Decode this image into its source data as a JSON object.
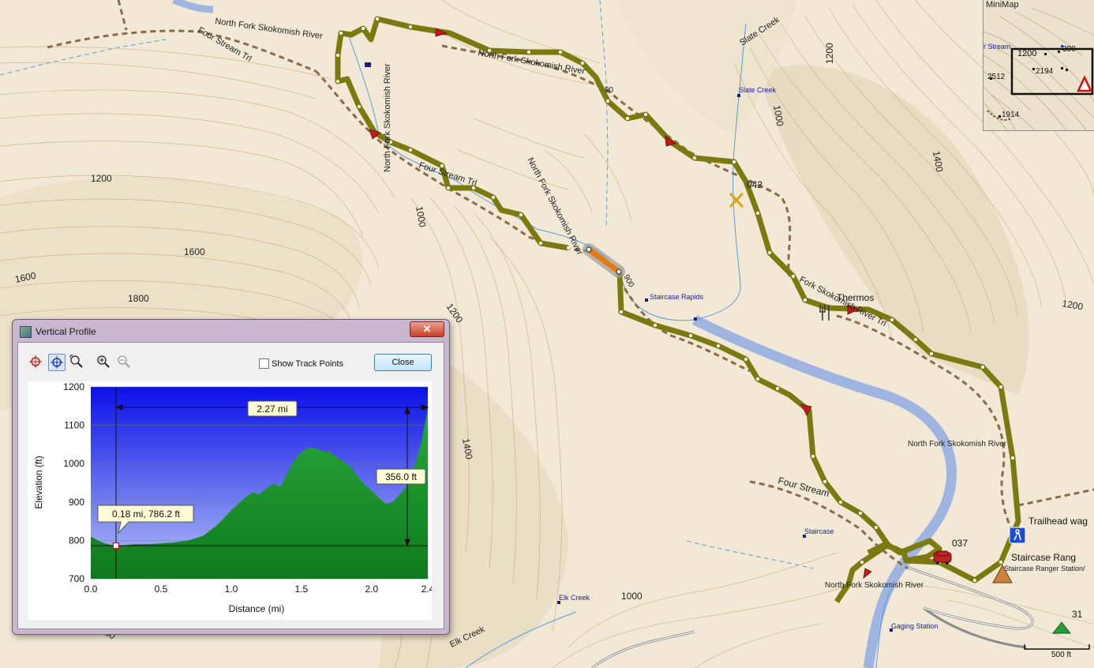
{
  "map": {
    "labels": {
      "north_fork_top": "North Fork Skokomish River",
      "four_stream_top": "Four Stream Trl",
      "slate_creek_label": "Slate Creek",
      "slate_creek_poi": "Slate Creek",
      "nf_river_vertical": "North Fork Skokomish River",
      "nf_river_mid": "North Fork Skokomish River",
      "nf_river_upper": "North Fork Skokomish River",
      "four_stream_mid": "Four Stream Trl",
      "staircase_rapids": "Staircase Rapids",
      "thermos": "Thermos",
      "fork_trl": "Fork Skokomish River Trl",
      "nf_river_right": "North Fork Skokomish River",
      "four_stream_low": "Four Stream",
      "staircase_poi": "Staircase",
      "trailhead": "Trailhead wag",
      "staircase_rang": "Staircase Rang",
      "staircase_ranger_station": "Staircase Ranger Station/",
      "nf_river_bottom": "North Fork Skokomish River",
      "elk_creek_poi": "Elk Creek",
      "elk_creek_label": "Elk Creek",
      "gaging_station": "Gaging Station",
      "wp_042": "042",
      "wp_037": "037",
      "wp_31": "31",
      "wp_90": "90",
      "wp_900": "900",
      "scale": "500 ft"
    },
    "contours": {
      "c1200_a": "1200",
      "c1000_a": "1000",
      "c1600_a": "1600",
      "c1600_b": "1600",
      "c1800_a": "1800",
      "c1200_b": "1200",
      "c1000_b": "1000",
      "c1400_a": "1400",
      "c1200_c": "1200",
      "c1400_b": "1400",
      "c1000_c": "1000",
      "c1800_b": "180",
      "c1200_d": "1200"
    }
  },
  "minimap": {
    "title": "MiniMap",
    "labels": {
      "stream": "r Stream",
      "e1200": "1200",
      "e390": "390",
      "e2512": "2512",
      "e2194": "2194",
      "e1914": "1914"
    }
  },
  "dialog": {
    "title": "Vertical Profile",
    "close_x": "✕",
    "show_track_points": "Show Track Points",
    "close_button": "Close"
  },
  "chart_data": {
    "type": "area",
    "xlabel": "Distance   (mi)",
    "ylabel": "Elevation (ft)",
    "xlim": [
      0,
      2.4
    ],
    "ylim": [
      700,
      1200
    ],
    "x_ticks": [
      "0.0",
      "0.5",
      "1.0",
      "1.5",
      "2.0",
      "2.4"
    ],
    "y_ticks": [
      "1200",
      "1100",
      "1000",
      "900",
      "800",
      "700"
    ],
    "x": [
      0.0,
      0.05,
      0.1,
      0.15,
      0.18,
      0.25,
      0.3,
      0.4,
      0.5,
      0.6,
      0.7,
      0.8,
      0.9,
      1.0,
      1.05,
      1.1,
      1.15,
      1.2,
      1.25,
      1.3,
      1.35,
      1.4,
      1.45,
      1.5,
      1.55,
      1.6,
      1.65,
      1.7,
      1.75,
      1.8,
      1.85,
      1.9,
      1.95,
      2.0,
      2.05,
      2.1,
      2.15,
      2.2,
      2.25,
      2.3,
      2.35,
      2.4
    ],
    "y": [
      810,
      800,
      792,
      788,
      786.2,
      788,
      790,
      790,
      792,
      795,
      800,
      812,
      840,
      878,
      895,
      912,
      925,
      920,
      935,
      948,
      940,
      975,
      1010,
      1030,
      1042,
      1040,
      1032,
      1030,
      1018,
      1005,
      992,
      968,
      945,
      930,
      912,
      895,
      900,
      920,
      940,
      990,
      1050,
      1142
    ],
    "cursor_label": "0.18 mi, 786.2 ft",
    "distance_label": "2.27 mi",
    "elevation_label": "356.0 ft",
    "colors": {
      "sky_top": "#0a10e8",
      "sky_bottom": "#b8c6f4",
      "fill_top": "#2aa83a",
      "fill_bottom": "#0f7a1e"
    }
  }
}
